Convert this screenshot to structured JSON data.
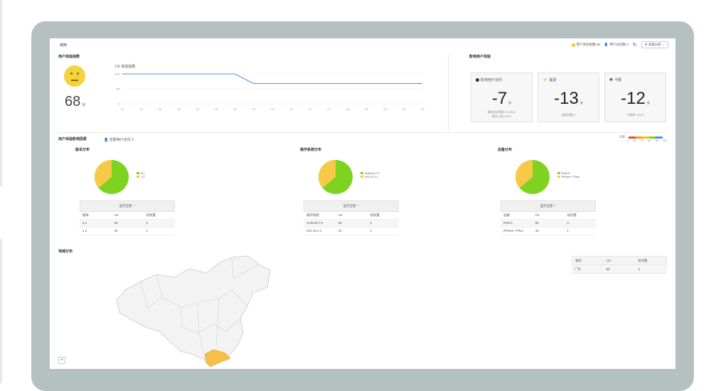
{
  "header": {
    "title": "使用",
    "pill1": "用户体验指数 68",
    "pill2": "用户访问数 2",
    "settings": "高级分析"
  },
  "experience": {
    "section_title": "用户体验指数",
    "score": "68",
    "score_unit": "分",
    "chart_title": "UX 体验指数"
  },
  "chart_data": {
    "type": "line",
    "title": "UX 体验指数",
    "ylim": [
      0,
      100
    ],
    "y_ticks": [
      "100",
      "50",
      "0"
    ],
    "x": [
      "7/4",
      "7/4",
      "7/4",
      "7/5",
      "7/5",
      "7/5",
      "7/6",
      "7/6",
      "7/6",
      "7/7",
      "7/7",
      "7/7",
      "7/8",
      "7/8",
      "7/8",
      "7/9",
      "7/9"
    ],
    "series": [
      {
        "values": [
          100,
          100,
          100,
          100,
          100,
          100,
          100,
          68,
          68,
          68,
          68,
          68,
          68,
          68,
          68,
          68,
          68
        ]
      }
    ]
  },
  "issues": {
    "section_title": "影响用户体验",
    "cards": [
      {
        "label": "影响用户访问",
        "value": "-7",
        "unit": "分",
        "sub1": "影响访问频次 13.25%",
        "sub2": "相比上周 100%"
      },
      {
        "label": "崩溃",
        "value": "-13",
        "unit": "分",
        "sub1": "崩溃次数 2",
        "sub2": ""
      },
      {
        "label": "卡顿",
        "value": "-12",
        "unit": "分",
        "sub1": "卡顿率 100%",
        "sub2": ""
      }
    ]
  },
  "distribution": {
    "section_title": "用户体验影响因素",
    "filter": "全部用户访问 3",
    "scale_label": "UX",
    "scale_ticks": [
      "0",
      "50",
      "70",
      "80",
      "90",
      "100"
    ],
    "blocks": [
      {
        "title": "版本分布",
        "legend": [
          "6.1",
          "1.2"
        ],
        "toggle": "显示全部",
        "cols": [
          "版本",
          "UX",
          "访问量"
        ],
        "rows": [
          [
            "6.1",
            "90",
            "2"
          ],
          [
            "1.2",
            "24",
            "1"
          ]
        ]
      },
      {
        "title": "操作系统分布",
        "legend": [
          "Android 7.0",
          "iOS 10.1.1"
        ],
        "toggle": "显示全部",
        "cols": [
          "操作系统",
          "UX",
          "访问量"
        ],
        "rows": [
          [
            "Android 7.0",
            "90",
            "2"
          ],
          [
            "iOS 10.1.1",
            "21",
            "1"
          ]
        ]
      },
      {
        "title": "设备分布",
        "legend": [
          "iPad 5",
          "iPhone 7 Plus"
        ],
        "toggle": "显示全部",
        "cols": [
          "设备",
          "UX",
          "访问量"
        ],
        "rows": [
          [
            "iPad 5",
            "90",
            "2"
          ],
          [
            "iPhone 7 Plus",
            "40",
            "1"
          ]
        ]
      }
    ]
  },
  "region": {
    "section_title": "地域分布",
    "cols": [
      "省份",
      "UX",
      "访问量"
    ],
    "rows": [
      [
        "广东",
        "68",
        "3"
      ]
    ],
    "zoom_label": "+"
  },
  "colors": {
    "pie_green": "#7ed321",
    "pie_yellow": "#f8c948",
    "line": "#4a90e2",
    "highlight": "#f5c04a"
  }
}
